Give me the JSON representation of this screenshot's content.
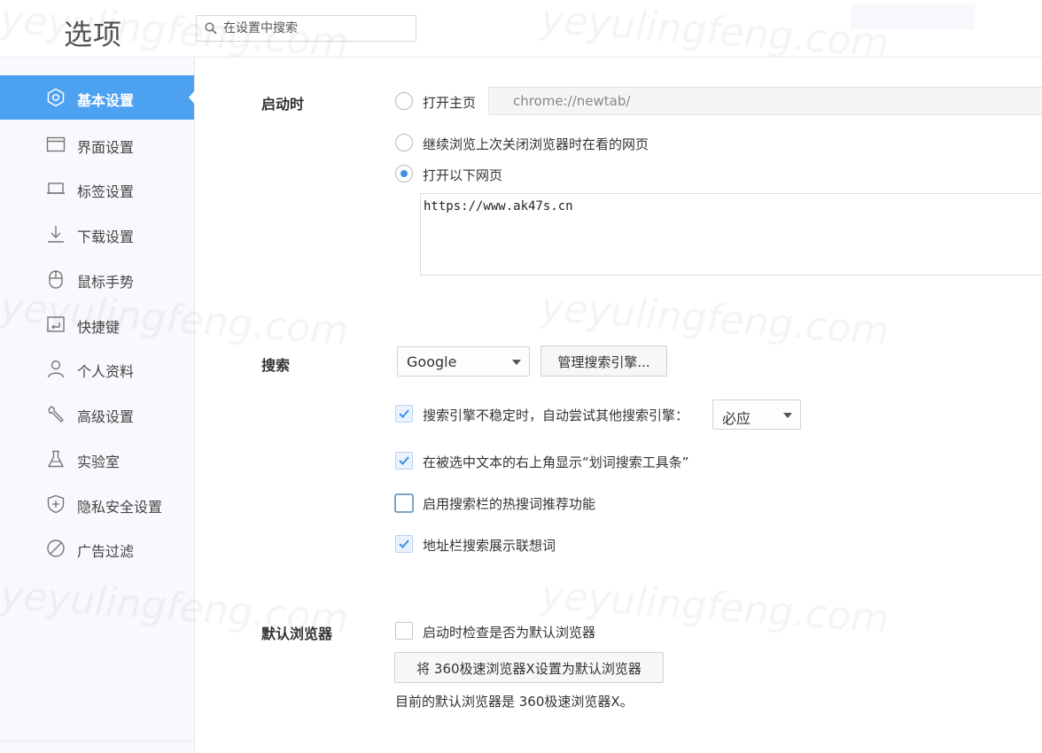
{
  "header": {
    "title": "选项",
    "search_placeholder": "在设置中搜索"
  },
  "sidebar": {
    "items": [
      {
        "label": "基本设置",
        "icon": "gear-icon",
        "active": true
      },
      {
        "label": "界面设置",
        "icon": "window-icon",
        "active": false
      },
      {
        "label": "标签设置",
        "icon": "tab-icon",
        "active": false
      },
      {
        "label": "下载设置",
        "icon": "download-icon",
        "active": false
      },
      {
        "label": "鼠标手势",
        "icon": "mouse-icon",
        "active": false
      },
      {
        "label": "快捷键",
        "icon": "keyboard-icon",
        "active": false
      },
      {
        "label": "个人资料",
        "icon": "user-icon",
        "active": false
      },
      {
        "label": "高级设置",
        "icon": "wrench-icon",
        "active": false
      },
      {
        "label": "实验室",
        "icon": "flask-icon",
        "active": false
      },
      {
        "label": "隐私安全设置",
        "icon": "shield-icon",
        "active": false
      },
      {
        "label": "广告过滤",
        "icon": "block-icon",
        "active": false
      }
    ]
  },
  "startup": {
    "title": "启动时",
    "option_home": "打开主页",
    "home_url": "chrome://newtab/",
    "option_continue": "继续浏览上次关闭浏览器时在看的网页",
    "option_open_pages": "打开以下网页",
    "selected": "open_pages",
    "pages_text": "https://www.ak47s.cn"
  },
  "search": {
    "title": "搜索",
    "engine": "Google",
    "manage_button": "管理搜索引擎...",
    "fallback_label": "搜索引擎不稳定时，自动尝试其他搜索引擎：",
    "fallback_engine": "必应",
    "fallback_checked": true,
    "toolbar_label": "在被选中文本的右上角显示“划词搜索工具条”",
    "toolbar_checked": true,
    "hotwords_label": "启用搜索栏的热搜词推荐功能",
    "hotwords_checked": false,
    "suggest_label": "地址栏搜索展示联想词",
    "suggest_checked": true
  },
  "default_browser": {
    "title": "默认浏览器",
    "check_label": "启动时检查是否为默认浏览器",
    "check_checked": false,
    "set_button": "将 360极速浏览器X设置为默认浏览器",
    "status": "目前的默认浏览器是 360极速浏览器X。"
  },
  "colors": {
    "accent": "#4ca1f0",
    "radio_dot": "#3c8ee8",
    "check_mark": "#3c8ee8"
  }
}
